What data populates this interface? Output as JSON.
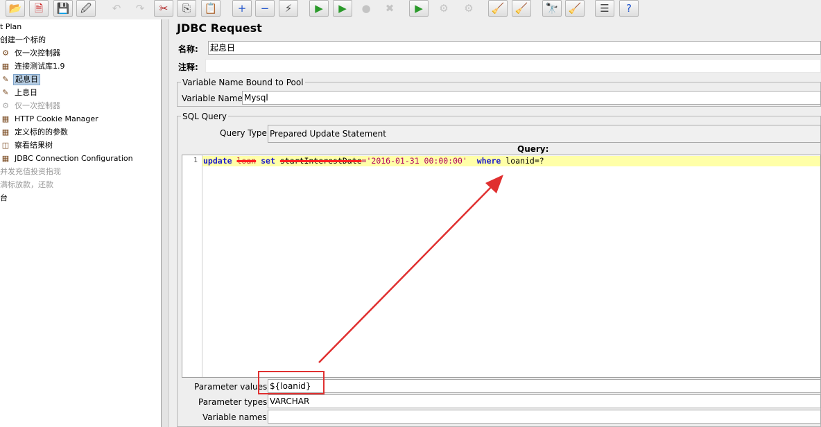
{
  "toolbar": {
    "buttons": [
      {
        "icon": "open-icon",
        "glyph": "📂",
        "active": true
      },
      {
        "icon": "close-icon",
        "glyph": "🗎",
        "active": true
      },
      {
        "icon": "save-icon",
        "glyph": "💾",
        "active": true
      },
      {
        "icon": "save-as-icon",
        "glyph": "🖉",
        "active": true
      },
      {
        "icon": "undo-icon",
        "glyph": "↶",
        "active": false
      },
      {
        "icon": "redo-icon",
        "glyph": "↷",
        "active": false
      },
      {
        "icon": "cut-icon",
        "glyph": "✂",
        "active": true
      },
      {
        "icon": "copy-icon",
        "glyph": "⎘",
        "active": true
      },
      {
        "icon": "paste-icon",
        "glyph": "📋",
        "active": true
      },
      {
        "icon": "expand-icon",
        "glyph": "+",
        "active": true
      },
      {
        "icon": "collapse-icon",
        "glyph": "−",
        "active": true
      },
      {
        "icon": "toggle-icon",
        "glyph": "⚡",
        "active": true
      },
      {
        "icon": "start-icon",
        "glyph": "▶",
        "active": true
      },
      {
        "icon": "start-no-pause-icon",
        "glyph": "▶",
        "active": true
      },
      {
        "icon": "stop-icon",
        "glyph": "●",
        "active": false
      },
      {
        "icon": "shutdown-icon",
        "glyph": "✖",
        "active": false
      },
      {
        "icon": "remote-start-icon",
        "glyph": "▶",
        "active": true
      },
      {
        "icon": "remote-stop-icon",
        "glyph": "⚙",
        "active": false
      },
      {
        "icon": "remote-shutdown-icon",
        "glyph": "⚙",
        "active": false
      },
      {
        "icon": "clear-icon",
        "glyph": "🧹",
        "active": true
      },
      {
        "icon": "clear-all-icon",
        "glyph": "🧹",
        "active": true
      },
      {
        "icon": "search-icon",
        "glyph": "🔭",
        "active": true
      },
      {
        "icon": "reset-search-icon",
        "glyph": "🧹",
        "active": true
      },
      {
        "icon": "function-helper-icon",
        "glyph": "☰",
        "active": true
      },
      {
        "icon": "help-icon",
        "glyph": "?",
        "active": true
      }
    ]
  },
  "tree": {
    "items": [
      {
        "label": "t Plan",
        "icon": "",
        "selected": false,
        "disabled": false,
        "indent": 0
      },
      {
        "label": "创建一个标的",
        "icon": "",
        "selected": false,
        "disabled": false,
        "indent": 0
      },
      {
        "label": "仅一次控制器",
        "icon": "⚙",
        "selected": false,
        "disabled": false,
        "indent": 1
      },
      {
        "label": "连接测试库1.9",
        "icon": "▦",
        "selected": false,
        "disabled": false,
        "indent": 1
      },
      {
        "label": "起息日",
        "icon": "✎",
        "selected": true,
        "disabled": false,
        "indent": 1
      },
      {
        "label": "上息日",
        "icon": "✎",
        "selected": false,
        "disabled": false,
        "indent": 1
      },
      {
        "label": "仅一次控制器",
        "icon": "⚙",
        "selected": false,
        "disabled": true,
        "indent": 1
      },
      {
        "label": "HTTP Cookie Manager",
        "icon": "▦",
        "selected": false,
        "disabled": false,
        "indent": 1
      },
      {
        "label": "定义标的的参数",
        "icon": "▦",
        "selected": false,
        "disabled": false,
        "indent": 1
      },
      {
        "label": "察看结果树",
        "icon": "◫",
        "selected": false,
        "disabled": false,
        "indent": 1
      },
      {
        "label": "JDBC Connection Configuration",
        "icon": "▦",
        "selected": false,
        "disabled": false,
        "indent": 1
      },
      {
        "label": "并发充值投资指现",
        "icon": "",
        "selected": false,
        "disabled": true,
        "indent": 0
      },
      {
        "label": "满标放款，还款",
        "icon": "",
        "selected": false,
        "disabled": true,
        "indent": 0
      },
      {
        "label": "台",
        "icon": "",
        "selected": false,
        "disabled": false,
        "indent": 0
      }
    ]
  },
  "panel": {
    "title": "JDBC Request",
    "name_label": "名称:",
    "name_value": "起息日",
    "comment_label": "注释:",
    "comment_value": "",
    "pool_group_title": "Variable Name Bound to Pool",
    "variable_name_label": "Variable Name:",
    "variable_name_value": "Mysql",
    "sql_group_title": "SQL Query",
    "query_type_label": "Query Type:",
    "query_type_value": "Prepared Update Statement",
    "query_header": "Query:",
    "query_line_number": "1",
    "query": {
      "update_kw": "update",
      "table": "loan",
      "set_kw": "set",
      "column": "startInterestDate",
      "value": "='2016-01-31 00:00:00'",
      "where_kw": "where",
      "condition": "loanid=?"
    },
    "param_values_label": "Parameter values:",
    "param_values_value": "${loanid}",
    "param_types_label": "Parameter types:",
    "param_types_value": "VARCHAR",
    "variable_names_label": "Variable names:",
    "variable_names_value": ""
  },
  "annotation": {
    "color": "#e03030"
  }
}
